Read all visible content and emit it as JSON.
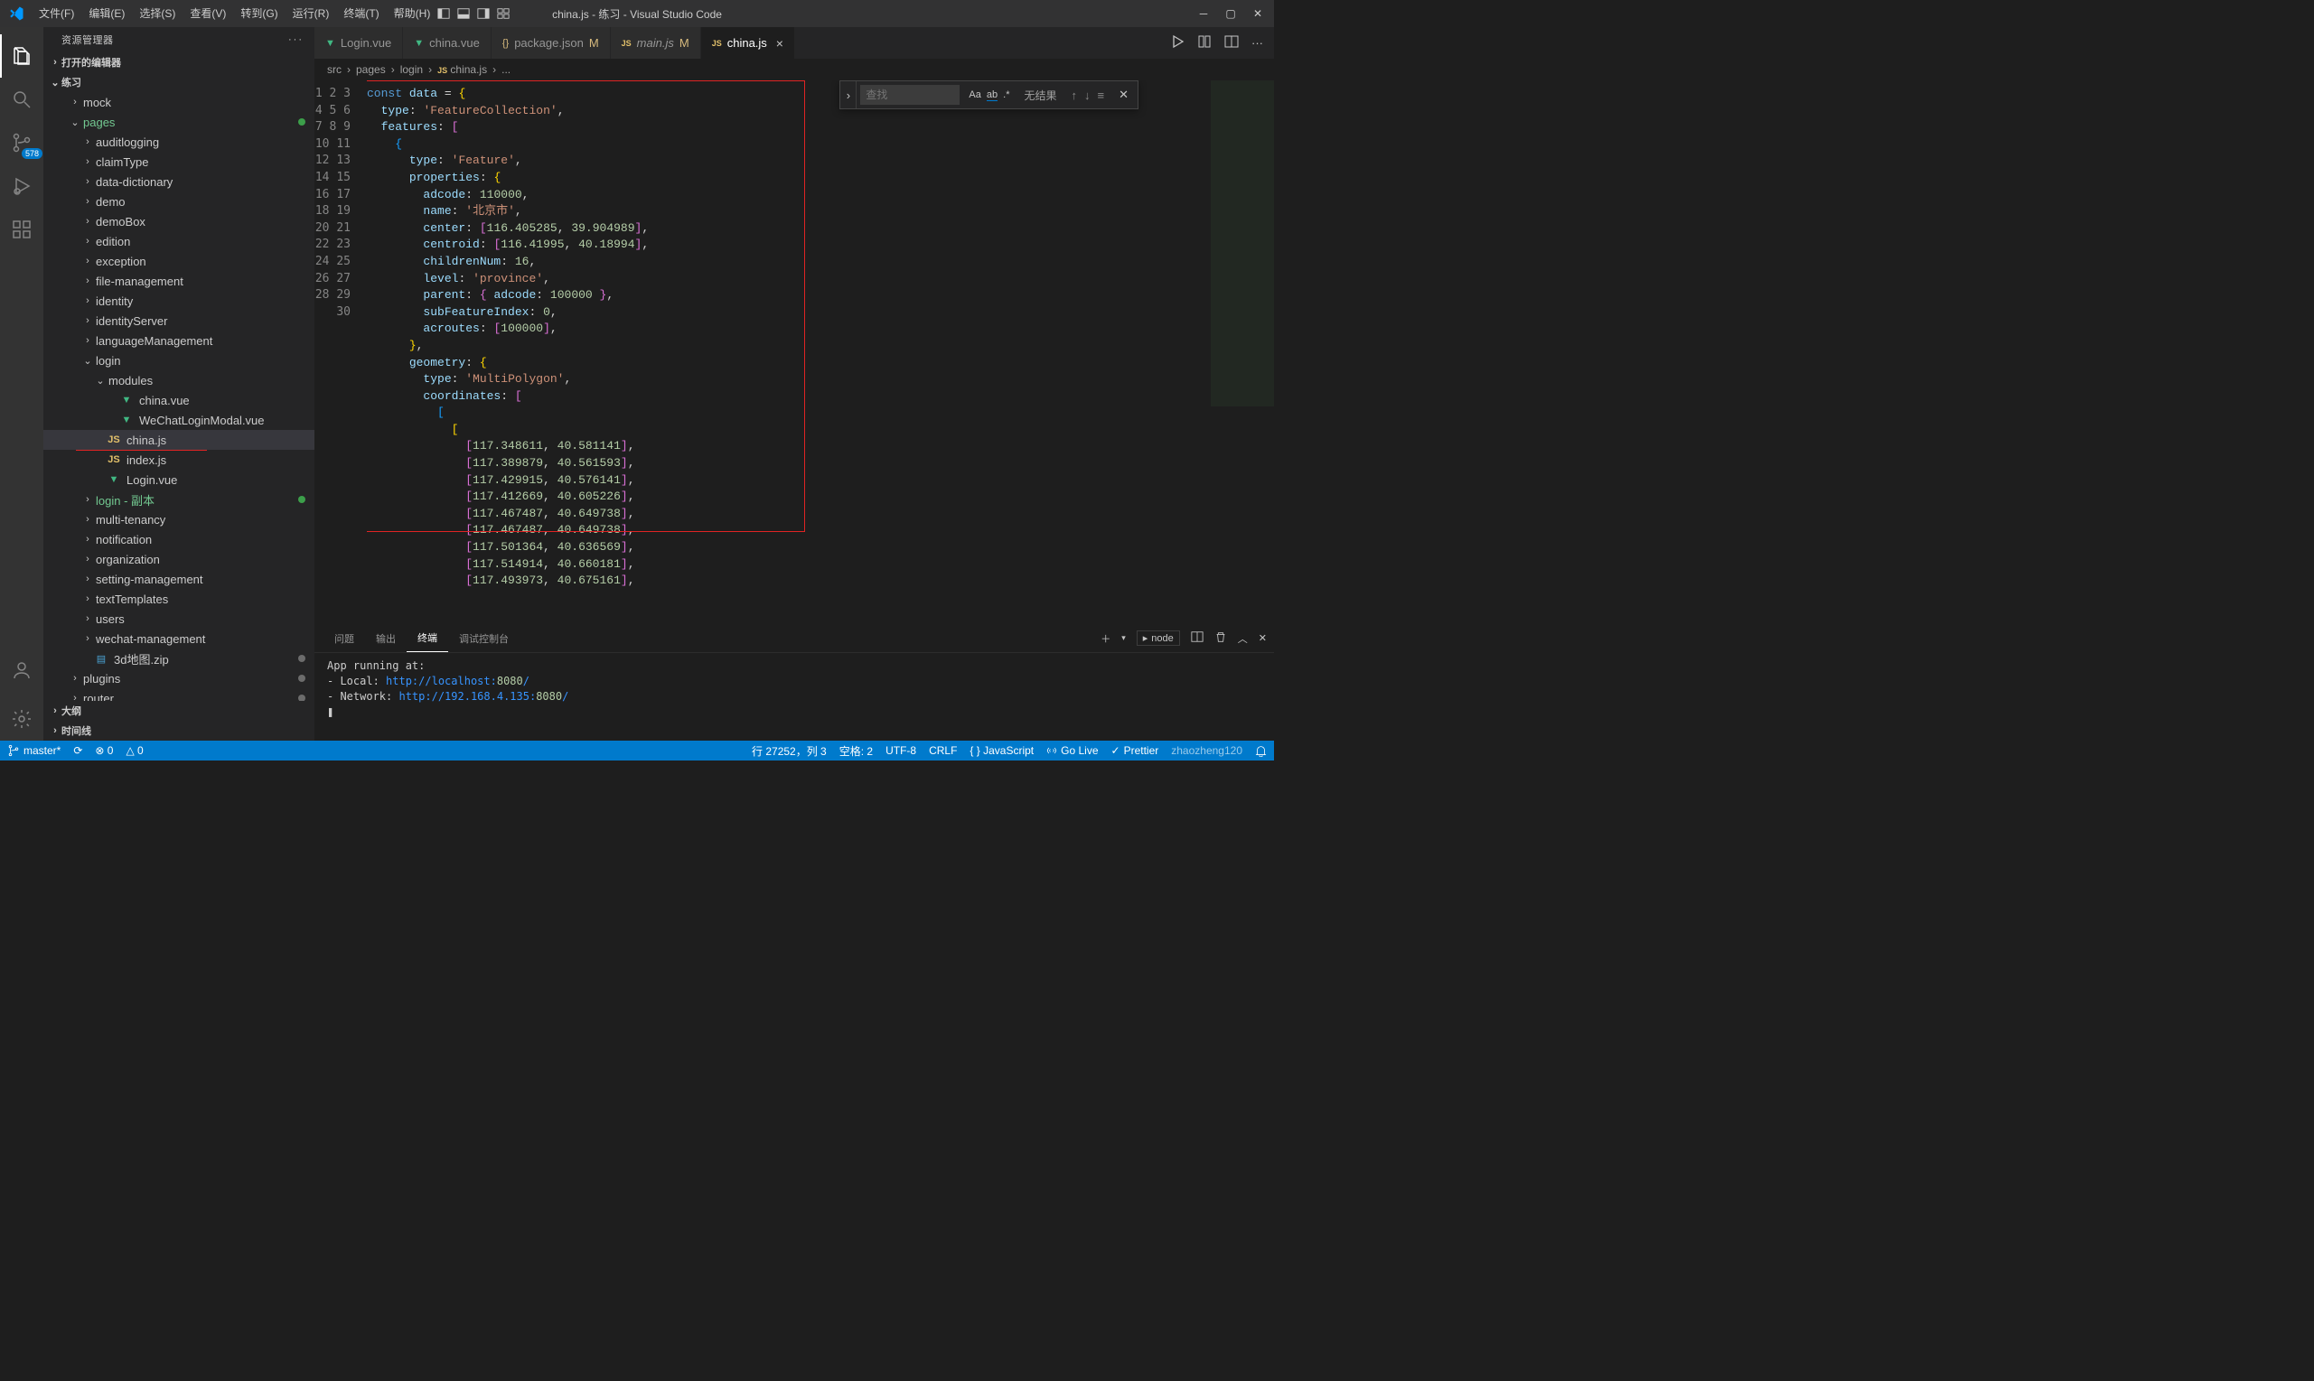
{
  "title": "china.js - 练习 - Visual Studio Code",
  "menu": [
    "文件(F)",
    "编辑(E)",
    "选择(S)",
    "查看(V)",
    "转到(G)",
    "运行(R)",
    "终端(T)",
    "帮助(H)"
  ],
  "activity_badge": "578",
  "sidebar": {
    "title": "资源管理器",
    "open_editors": "打开的编辑器",
    "project": "练习",
    "outline": "大纲",
    "timeline": "时间线"
  },
  "explorer": {
    "items": [
      {
        "depth": 2,
        "chev": ">",
        "label": "mock"
      },
      {
        "depth": 2,
        "chev": "v",
        "label": "pages",
        "green": true,
        "cls": "col-green"
      },
      {
        "depth": 3,
        "chev": ">",
        "label": "auditlogging"
      },
      {
        "depth": 3,
        "chev": ">",
        "label": "claimType"
      },
      {
        "depth": 3,
        "chev": ">",
        "label": "data-dictionary"
      },
      {
        "depth": 3,
        "chev": ">",
        "label": "demo"
      },
      {
        "depth": 3,
        "chev": ">",
        "label": "demoBox"
      },
      {
        "depth": 3,
        "chev": ">",
        "label": "edition"
      },
      {
        "depth": 3,
        "chev": ">",
        "label": "exception"
      },
      {
        "depth": 3,
        "chev": ">",
        "label": "file-management"
      },
      {
        "depth": 3,
        "chev": ">",
        "label": "identity"
      },
      {
        "depth": 3,
        "chev": ">",
        "label": "identityServer"
      },
      {
        "depth": 3,
        "chev": ">",
        "label": "languageManagement"
      },
      {
        "depth": 3,
        "chev": "v",
        "label": "login"
      },
      {
        "depth": 4,
        "chev": "v",
        "label": "modules"
      },
      {
        "depth": 5,
        "ico": "vue",
        "label": "china.vue"
      },
      {
        "depth": 5,
        "ico": "vue",
        "label": "WeChatLoginModal.vue"
      },
      {
        "depth": 4,
        "ico": "js",
        "label": "china.js",
        "selected": true
      },
      {
        "depth": 4,
        "ico": "js",
        "label": "index.js"
      },
      {
        "depth": 4,
        "ico": "vue",
        "label": "Login.vue"
      },
      {
        "depth": 3,
        "chev": ">",
        "label": "login - 副本",
        "green": true,
        "cls": "col-green"
      },
      {
        "depth": 3,
        "chev": ">",
        "label": "multi-tenancy"
      },
      {
        "depth": 3,
        "chev": ">",
        "label": "notification"
      },
      {
        "depth": 3,
        "chev": ">",
        "label": "organization"
      },
      {
        "depth": 3,
        "chev": ">",
        "label": "setting-management"
      },
      {
        "depth": 3,
        "chev": ">",
        "label": "textTemplates"
      },
      {
        "depth": 3,
        "chev": ">",
        "label": "users"
      },
      {
        "depth": 3,
        "chev": ">",
        "label": "wechat-management"
      },
      {
        "depth": 3,
        "ico": "zip",
        "label": "3d地图.zip",
        "gray": true
      },
      {
        "depth": 2,
        "chev": ">",
        "label": "plugins",
        "gray": true
      },
      {
        "depth": 2,
        "chev": ">",
        "label": "router",
        "gray": true
      }
    ]
  },
  "tabs": [
    {
      "ico": "vue",
      "label": "Login.vue"
    },
    {
      "ico": "vue",
      "label": "china.vue"
    },
    {
      "ico": "json",
      "label": "package.json",
      "mod": "M"
    },
    {
      "ico": "js",
      "italic": true,
      "label": "main.js",
      "mod": "M"
    },
    {
      "ico": "js",
      "label": "china.js",
      "active": true,
      "close": true
    }
  ],
  "breadcrumbs": [
    "src",
    "pages",
    "login",
    "china.js",
    "..."
  ],
  "bc_icon_index": 3,
  "code_lines": [
    "<span class='kw'>const</span> <span class='id2'>data</span> <span class='pun'>=</span> <span class='brc0'>{</span>",
    "  <span class='id2'>type</span><span class='pun'>:</span> <span class='str'>'FeatureCollection'</span><span class='pun'>,</span>",
    "  <span class='id2'>features</span><span class='pun'>:</span> <span class='brc1'>[</span>",
    "    <span class='brc2'>{</span>",
    "      <span class='id2'>type</span><span class='pun'>:</span> <span class='str'>'Feature'</span><span class='pun'>,</span>",
    "      <span class='id2'>properties</span><span class='pun'>:</span> <span class='brc0'>{</span>",
    "        <span class='id2'>adcode</span><span class='pun'>:</span> <span class='num'>110000</span><span class='pun'>,</span>",
    "        <span class='id2'>name</span><span class='pun'>:</span> <span class='str'>'北京市'</span><span class='pun'>,</span>",
    "        <span class='id2'>center</span><span class='pun'>:</span> <span class='brc1'>[</span><span class='num'>116.405285</span><span class='pun'>,</span> <span class='num'>39.904989</span><span class='brc1'>]</span><span class='pun'>,</span>",
    "        <span class='id2'>centroid</span><span class='pun'>:</span> <span class='brc1'>[</span><span class='num'>116.41995</span><span class='pun'>,</span> <span class='num'>40.18994</span><span class='brc1'>]</span><span class='pun'>,</span>",
    "        <span class='id2'>childrenNum</span><span class='pun'>:</span> <span class='num'>16</span><span class='pun'>,</span>",
    "        <span class='id2'>level</span><span class='pun'>:</span> <span class='str'>'province'</span><span class='pun'>,</span>",
    "        <span class='id2'>parent</span><span class='pun'>:</span> <span class='brc1'>{</span> <span class='id2'>adcode</span><span class='pun'>:</span> <span class='num'>100000</span> <span class='brc1'>}</span><span class='pun'>,</span>",
    "        <span class='id2'>subFeatureIndex</span><span class='pun'>:</span> <span class='num'>0</span><span class='pun'>,</span>",
    "        <span class='id2'>acroutes</span><span class='pun'>:</span> <span class='brc1'>[</span><span class='num'>100000</span><span class='brc1'>]</span><span class='pun'>,</span>",
    "      <span class='brc0'>}</span><span class='pun'>,</span>",
    "      <span class='id2'>geometry</span><span class='pun'>:</span> <span class='brc0'>{</span>",
    "        <span class='id2'>type</span><span class='pun'>:</span> <span class='str'>'MultiPolygon'</span><span class='pun'>,</span>",
    "        <span class='id2'>coordinates</span><span class='pun'>:</span> <span class='brc1'>[</span>",
    "          <span class='brc2'>[</span>",
    "            <span class='brc0'>[</span>",
    "              <span class='brc1'>[</span><span class='num'>117.348611</span><span class='pun'>,</span> <span class='num'>40.581141</span><span class='brc1'>]</span><span class='pun'>,</span>",
    "              <span class='brc1'>[</span><span class='num'>117.389879</span><span class='pun'>,</span> <span class='num'>40.561593</span><span class='brc1'>]</span><span class='pun'>,</span>",
    "              <span class='brc1'>[</span><span class='num'>117.429915</span><span class='pun'>,</span> <span class='num'>40.576141</span><span class='brc1'>]</span><span class='pun'>,</span>",
    "              <span class='brc1'>[</span><span class='num'>117.412669</span><span class='pun'>,</span> <span class='num'>40.605226</span><span class='brc1'>]</span><span class='pun'>,</span>",
    "              <span class='brc1'>[</span><span class='num'>117.467487</span><span class='pun'>,</span> <span class='num'>40.649738</span><span class='brc1'>]</span><span class='pun'>,</span>",
    "              <span class='brc1'>[</span><span class='num'>117.467487</span><span class='pun'>,</span> <span class='num'>40.649738</span><span class='brc1'>]</span><span class='pun'>,</span>",
    "              <span class='brc1'>[</span><span class='num'>117.501364</span><span class='pun'>,</span> <span class='num'>40.636569</span><span class='brc1'>]</span><span class='pun'>,</span>",
    "              <span class='brc1'>[</span><span class='num'>117.514914</span><span class='pun'>,</span> <span class='num'>40.660181</span><span class='brc1'>]</span><span class='pun'>,</span>",
    "              <span class='brc1'>[</span><span class='num'>117.493973</span><span class='pun'>,</span> <span class='num'>40.675161</span><span class='brc1'>]</span><span class='pun'>,</span>"
  ],
  "find": {
    "placeholder": "查找",
    "aa": "Aa",
    "ab": "ab",
    "re": ".*",
    "result": "无结果"
  },
  "panel": {
    "tabs": [
      "问题",
      "输出",
      "终端",
      "调试控制台"
    ],
    "active": 2,
    "node": "node",
    "lines": [
      {
        "t": "App running at:"
      },
      {
        "t": "- Local:   ",
        "u": "http://localhost:",
        "p": "8080",
        "s": "/"
      },
      {
        "t": "- Network: ",
        "u": "http://192.168.4.135:",
        "p": "8080",
        "s": "/"
      },
      {
        "t": ""
      },
      {
        "t": "❚"
      }
    ]
  },
  "status": {
    "branch": "master*",
    "sync": "⟳",
    "errors": "⊗ 0",
    "warnings": "△ 0",
    "ln": "行 27252，列 3",
    "spaces": "空格: 2",
    "enc": "UTF-8",
    "eol": "CRLF",
    "lang": "{ }  JavaScript",
    "golive": "Go Live",
    "prettier": "Prettier",
    "watermark": "zhaozheng120"
  }
}
